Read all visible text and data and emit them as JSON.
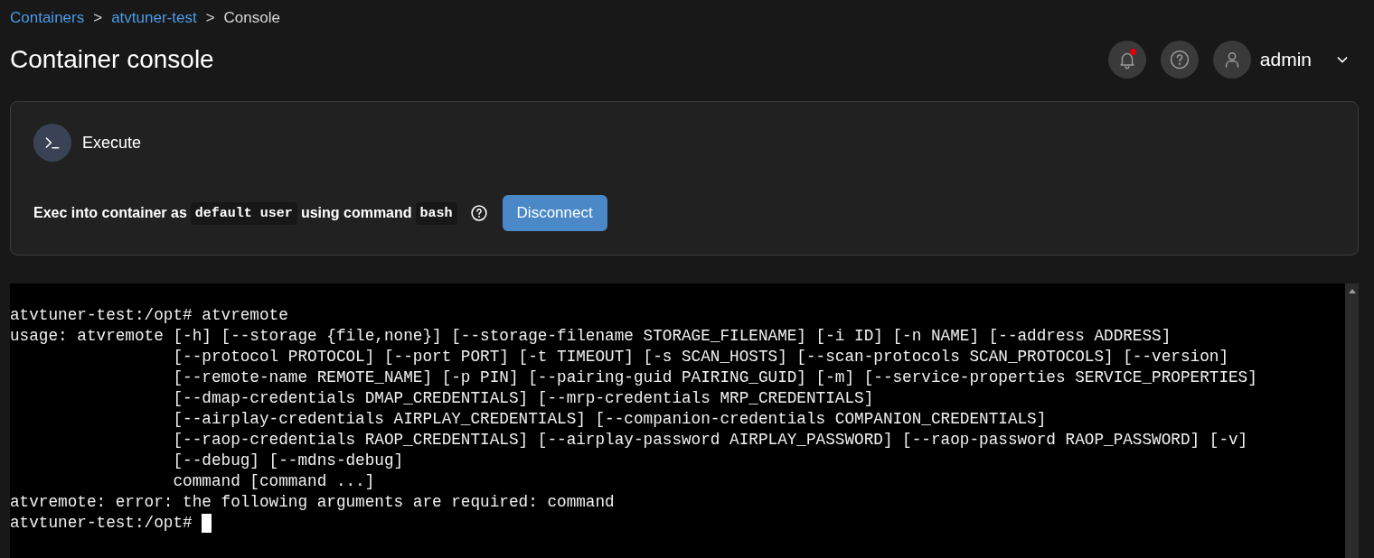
{
  "breadcrumbs": [
    {
      "label": "Containers",
      "link": true
    },
    {
      "label": "atvtuner-test",
      "link": true
    },
    {
      "label": "Console",
      "link": false
    }
  ],
  "breadcrumb_separator": ">",
  "page_title": "Container console",
  "header": {
    "notifications_unread": true,
    "user": "admin"
  },
  "execute_panel": {
    "title": "Execute",
    "parts": [
      {
        "kind": "text",
        "text": "Exec into container as"
      },
      {
        "kind": "code",
        "text": "default user"
      },
      {
        "kind": "text",
        "text": "using command"
      },
      {
        "kind": "code",
        "text": "bash"
      }
    ],
    "button": "Disconnect"
  },
  "terminal": {
    "cursor_visible": true,
    "lines": [
      "atvtuner-test:/opt# atvremote",
      "usage: atvremote [-h] [--storage {file,none}] [--storage-filename STORAGE_FILENAME] [-i ID] [-n NAME] [--address ADDRESS]",
      "                 [--protocol PROTOCOL] [--port PORT] [-t TIMEOUT] [-s SCAN_HOSTS] [--scan-protocols SCAN_PROTOCOLS] [--version]",
      "                 [--remote-name REMOTE_NAME] [-p PIN] [--pairing-guid PAIRING_GUID] [-m] [--service-properties SERVICE_PROPERTIES]",
      "                 [--dmap-credentials DMAP_CREDENTIALS] [--mrp-credentials MRP_CREDENTIALS]",
      "                 [--airplay-credentials AIRPLAY_CREDENTIALS] [--companion-credentials COMPANION_CREDENTIALS]",
      "                 [--raop-credentials RAOP_CREDENTIALS] [--airplay-password AIRPLAY_PASSWORD] [--raop-password RAOP_PASSWORD] [-v]",
      "                 [--debug] [--mdns-debug]",
      "                 command [command ...]",
      "atvremote: error: the following arguments are required: command",
      "atvtuner-test:/opt# "
    ]
  }
}
